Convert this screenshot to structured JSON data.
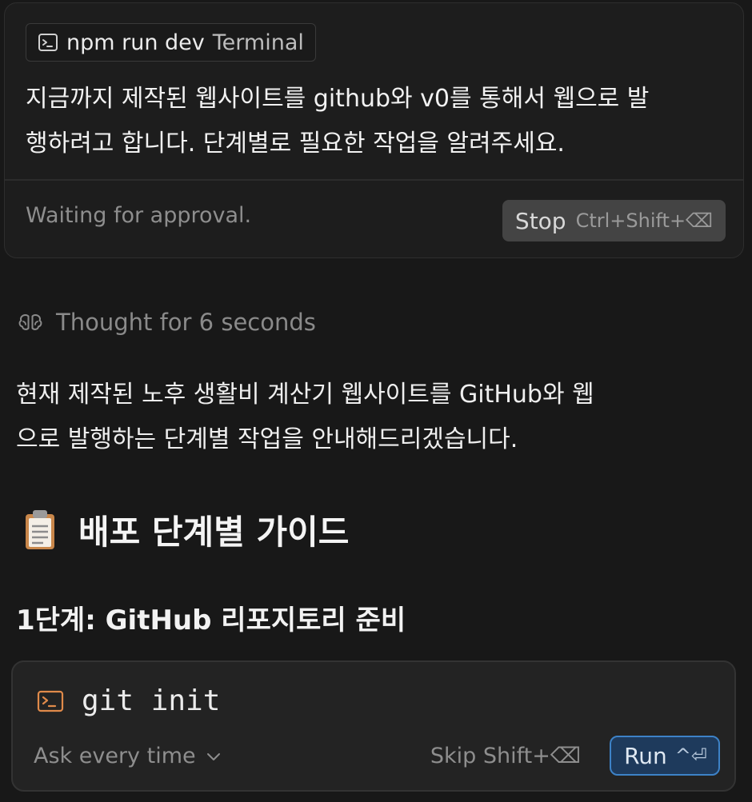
{
  "queued_message": {
    "terminal_chip": {
      "icon": "terminal-icon",
      "command": "npm run dev",
      "kind": "Terminal"
    },
    "text_line1": "지금까지 제작된 웹사이트를 github와 v0를 통해서 웹으로 발",
    "text_line2": "행하려고 합니다. 단계별로 필요한 작업을 알려주세요.",
    "status": "Waiting for approval.",
    "stop_button": {
      "label": "Stop",
      "shortcut": "Ctrl+Shift+⌫"
    }
  },
  "thought": {
    "icon": "brain-icon",
    "label": "Thought for 6 seconds"
  },
  "response": {
    "intro_line1": "현재 제작된 노후 생활비 계산기 웹사이트를 GitHub와 웹",
    "intro_line2": "으로 발행하는 단계별 작업을 안내해드리겠습니다.",
    "guide_heading": {
      "icon": "clipboard-icon",
      "text": "배포 단계별 가이드"
    },
    "step1_heading": "1단계: GitHub 리포지토리 준비"
  },
  "command_card": {
    "icon": "terminal-icon",
    "command": "git init",
    "mode_select": {
      "value": "Ask every time",
      "icon": "chevron-down-icon"
    },
    "skip": "Skip Shift+⌫",
    "run_button": {
      "label": "Run",
      "shortcut": "^⏎"
    }
  },
  "colors": {
    "background": "#181818",
    "card": "#1d1d1d",
    "run_accent": "#3d82c7",
    "terminal_icon_accent": "#e08a4a"
  }
}
